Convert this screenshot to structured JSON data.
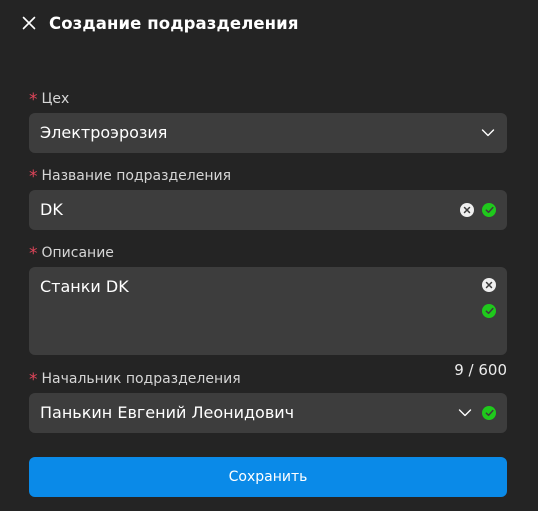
{
  "header": {
    "title": "Создание подразделения",
    "close_icon": "close-icon"
  },
  "fields": {
    "workshop": {
      "label": "Цех",
      "required_mark": "*",
      "value": "Электроэрозия"
    },
    "name": {
      "label": "Название подразделения",
      "required_mark": "*",
      "value": "DK"
    },
    "description": {
      "label": "Описание",
      "required_mark": "*",
      "value": "Станки DK",
      "counter": "9 / 600"
    },
    "head": {
      "label": "Начальник подразделения",
      "required_mark": "*",
      "value": "Панькин Евгений Леонидович"
    }
  },
  "actions": {
    "save_label": "Сохранить"
  },
  "colors": {
    "background": "#242424",
    "field_background": "#3d3d3d",
    "required": "#e0455a",
    "valid": "#1fc91c",
    "accent": "#0a8ae8"
  }
}
